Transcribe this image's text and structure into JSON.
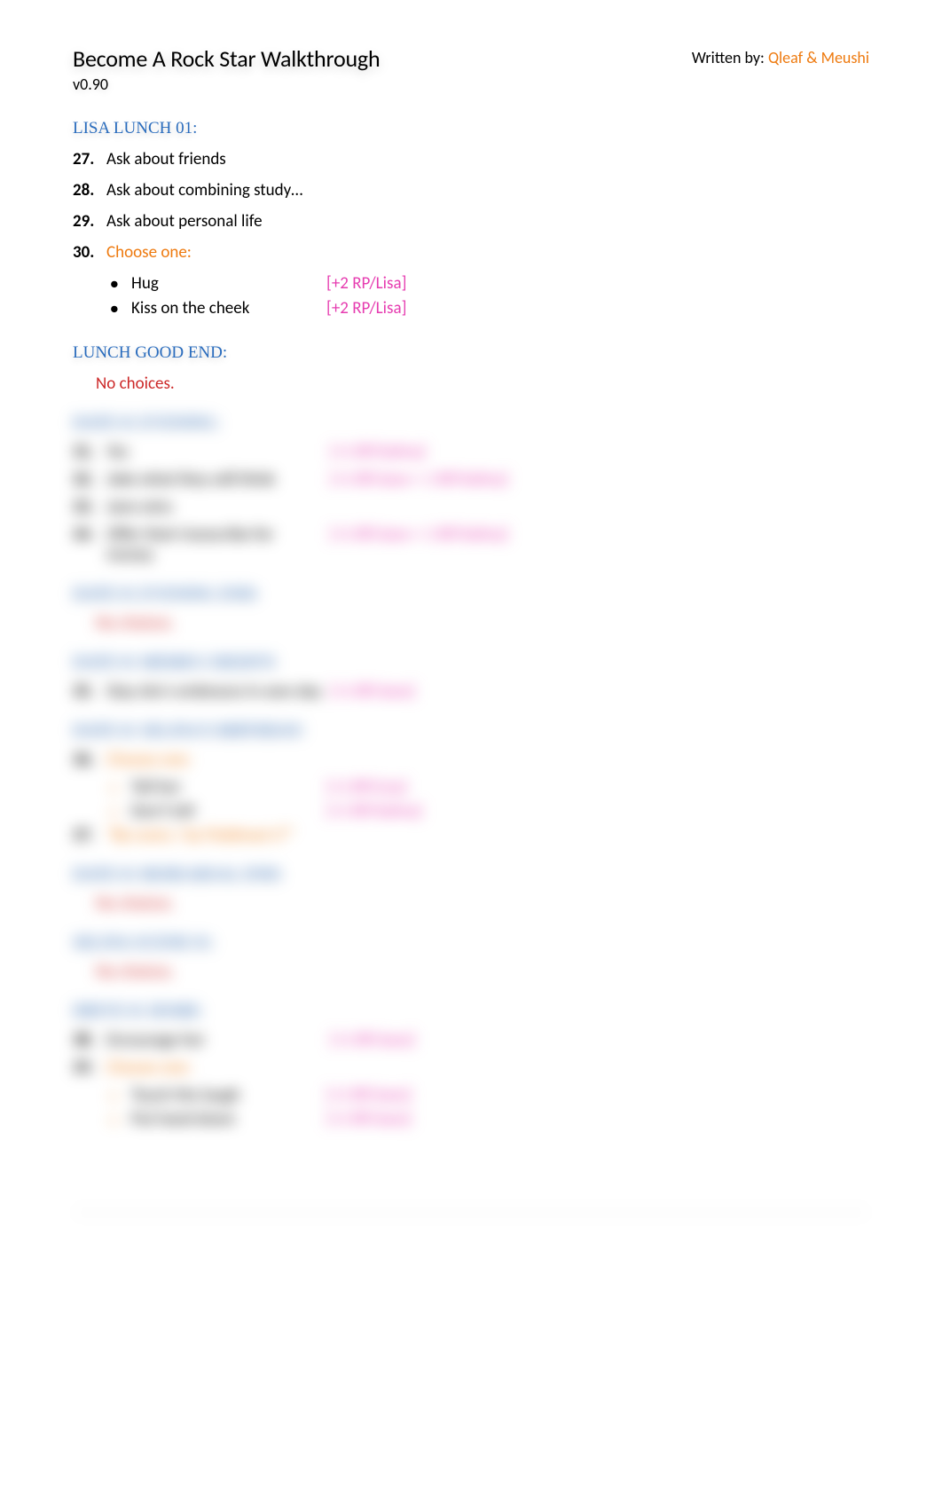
{
  "header": {
    "title": "Become A Rock Star Walkthrough",
    "version": "v0.90",
    "written_by_label": "Written by:",
    "authors": "Qleaf & Meushi"
  },
  "sections": {
    "lisa_lunch_01": {
      "heading": "LISA LUNCH 01:",
      "step27": {
        "num": "27.",
        "text": "Ask about friends"
      },
      "step28": {
        "num": "28.",
        "text": "Ask about combining study…"
      },
      "step29": {
        "num": "29.",
        "text": "Ask about personal life"
      },
      "step30": {
        "num": "30.",
        "text": "Choose one:"
      },
      "bullet_hug": {
        "text": "Hug",
        "reward": "[+2 RP/Lisa]"
      },
      "bullet_kiss": {
        "text": "Kiss on the cheek",
        "reward": "[+2 RP/Lisa]"
      }
    },
    "lunch_good": {
      "heading": "LUNCH GOOD END:",
      "no_choices": "No choices."
    },
    "date_night": {
      "heading": "DATE 01 EVENING:",
      "step31": {
        "num": "31.",
        "text": "Yes",
        "reward": "[+1 RP/Selina]"
      },
      "step32": {
        "num": "32.",
        "text": "Joke what they will think",
        "reward": "[+1 RP/Jane + 1 RP/Selina]"
      },
      "step33": {
        "num": "33.",
        "text": "Jane wins"
      },
      "step34": {
        "num": "34.",
        "text": "Offer their transcribe for money",
        "reward": "[+1 RP/Jane + 1 RP/Selina]"
      }
    },
    "evening_end": {
      "heading": "DATE 01 EVENING END:",
      "no_choices": "No choices."
    },
    "jane_call": {
      "heading": "DATE 01 MEMES CREDITS",
      "step35": {
        "num": "35.",
        "text": "Stay she's embraces in own day",
        "reward": "[+1 RP/Jane]"
      }
    },
    "selina_choice": {
      "heading": "DATE 01 SELINA'S BIRTHDAY:",
      "step36": {
        "num": "36.",
        "text": "Choose one:"
      },
      "bullet_tell": {
        "text": "Tell her",
        "reward": "[+1 RP/Lisa]"
      },
      "bullet_dont": {
        "text": "Don't tell",
        "reward": "[+1 RP/Selina]"
      },
      "step37": {
        "num": "37.",
        "text": "\"By-cores / by Fieldman's?\""
      }
    },
    "rehearsal": {
      "heading": "DATE 01 REHEARSAL END:",
      "no_choices": "No choices."
    },
    "selina_scene": {
      "heading": "SELINA SCENE 01:",
      "no_choices": "No choices."
    },
    "drive_home": {
      "heading": "DRIVE 01 HOME:",
      "step38": {
        "num": "38.",
        "text": "Encourage her",
        "reward": "[+1 RP/Jane]"
      },
      "step39": {
        "num": "39.",
        "text": "Choose one:"
      },
      "bullet_touch": {
        "text": "Touch the laugh",
        "reward": "[+1 RP/Jane]"
      },
      "bullet_put": {
        "text": "Put hand down",
        "reward": "[+1 RP/Jane]"
      }
    }
  }
}
